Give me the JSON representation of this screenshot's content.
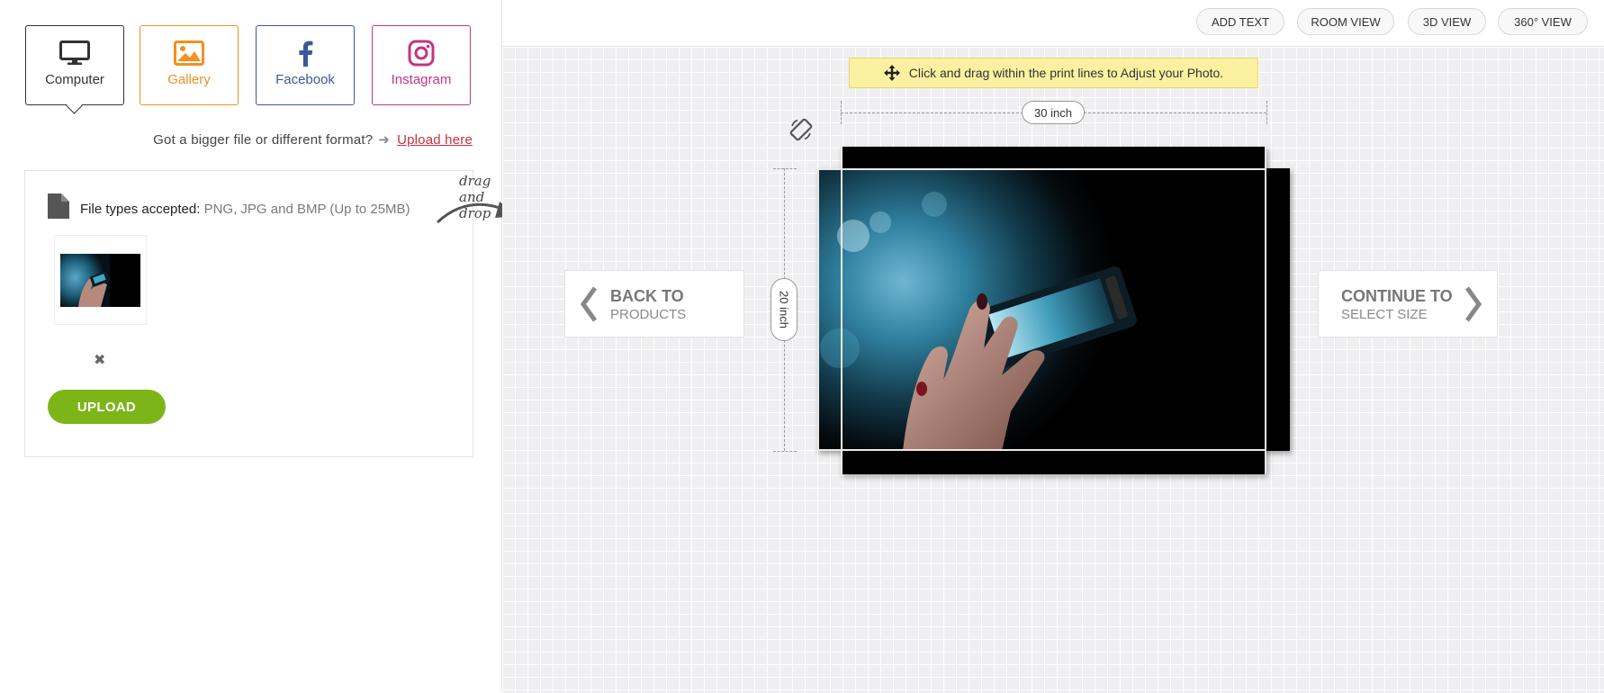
{
  "sources": {
    "computer": "Computer",
    "gallery": "Gallery",
    "facebook": "Facebook",
    "instagram": "Instagram",
    "active": "computer"
  },
  "bigger_file": {
    "question": "Got a bigger file or different format?",
    "link": "Upload here"
  },
  "upload_box": {
    "file_types_label": "File types accepted:",
    "file_types_value": "PNG, JPG and BMP (Up to 25MB)",
    "remove_glyph": "✖",
    "upload_button": "UPLOAD"
  },
  "drag_drop": "drag and drop",
  "toolbar": {
    "add_text": "ADD TEXT",
    "room_view": "ROOM VIEW",
    "view_3d": "3D VIEW",
    "view_360": "360° VIEW"
  },
  "hint": "Click and drag within the print lines to Adjust your Photo.",
  "dimensions": {
    "width": "30 inch",
    "height": "20 inch"
  },
  "nav": {
    "back_big": "BACK TO",
    "back_small": "PRODUCTS",
    "continue_big": "CONTINUE TO",
    "continue_small": "SELECT SIZE"
  },
  "colors": {
    "gallery": "#f29021",
    "facebook": "#3b5998",
    "instagram": "#c13584",
    "upload_green": "#7cb518",
    "hint_yellow": "#fbf1a0"
  },
  "icons": {
    "computer": "monitor-icon",
    "gallery": "image-icon",
    "facebook": "facebook-icon",
    "instagram": "instagram-icon",
    "file": "file-icon",
    "move": "move-arrows-icon",
    "rotate": "rotate-phone-icon"
  }
}
